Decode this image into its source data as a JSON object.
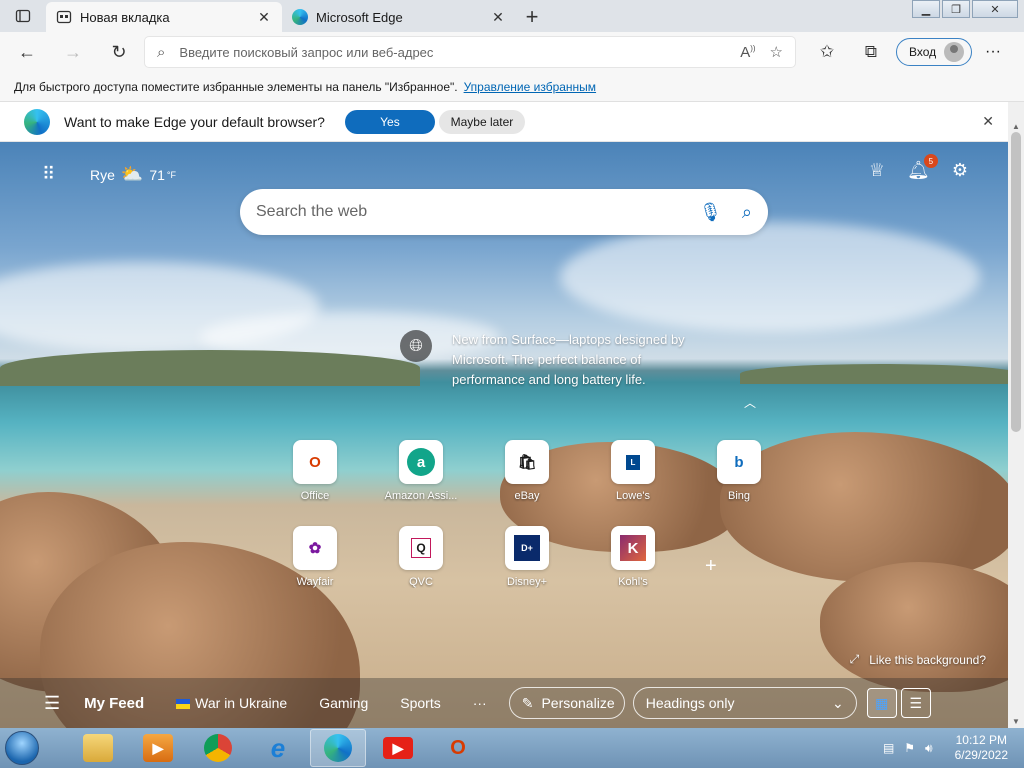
{
  "tabs": [
    {
      "title": "Новая вкладка"
    },
    {
      "title": "Microsoft Edge"
    }
  ],
  "address": {
    "placeholder": "Введите поисковый запрос или веб-адрес"
  },
  "nav": {
    "login_label": "Вход"
  },
  "favbar": {
    "text": "Для быстрого доступа поместите избранные элементы на панель \"Избранное\".",
    "link": "Управление избранным"
  },
  "banner": {
    "message": "Want to make Edge your default browser?",
    "yes": "Yes",
    "later": "Maybe later"
  },
  "weather": {
    "city": "Rye",
    "temp": "71",
    "unit": "°F"
  },
  "notifications": {
    "count": "5"
  },
  "search": {
    "placeholder": "Search the web"
  },
  "promo": {
    "text": "New from Surface—laptops designed by Microsoft. The perfect balance of performance and long battery life."
  },
  "tiles": [
    {
      "label": "Office",
      "glyph": "O",
      "color": "#d83b01"
    },
    {
      "label": "Amazon Assi...",
      "glyph": "a",
      "color": "#12a58a"
    },
    {
      "label": "eBay",
      "glyph": "🛍",
      "color": "#333333"
    },
    {
      "label": "Lowe's",
      "glyph": "L",
      "color": "#004990"
    },
    {
      "label": "Bing",
      "glyph": "b",
      "color": "#0f6cbd"
    },
    {
      "label": "Wayfair",
      "glyph": "✿",
      "color": "#7b189f"
    },
    {
      "label": "QVC",
      "glyph": "Q",
      "color": "#222222"
    },
    {
      "label": "Disney+",
      "glyph": "D+",
      "color": "#0a2a6b"
    },
    {
      "label": "Kohl's",
      "glyph": "K",
      "color": "#8a2b6f"
    }
  ],
  "like_bg": "Like this background?",
  "feed": {
    "my_feed": "My Feed",
    "items": [
      "War in Ukraine",
      "Gaming",
      "Sports"
    ],
    "more": "···",
    "personalize": "Personalize",
    "headings": "Headings only"
  },
  "clock": {
    "time": "10:12 PM",
    "date": "6/29/2022"
  },
  "colors": {
    "accent": "#0f6cbd",
    "taskbar": "#7fa3c4"
  }
}
